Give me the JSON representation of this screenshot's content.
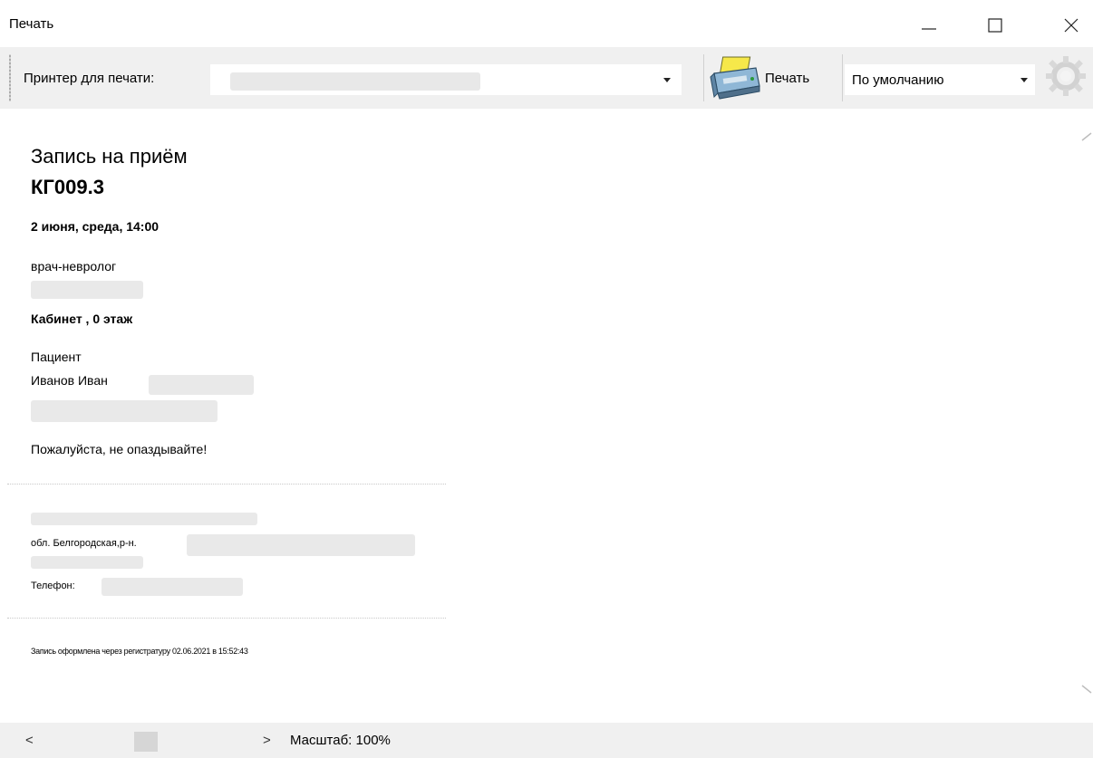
{
  "window": {
    "title": "Печать",
    "controls": {
      "minimize_icon": "minimize-icon",
      "maximize_icon": "maximize-icon",
      "close_icon": "close-icon"
    }
  },
  "toolbar": {
    "printer_label": "Принтер для печати:",
    "printer_value": "",
    "print_button_label": "Печать",
    "print_icon": "printer-icon",
    "mode_value": "По умолчанию",
    "settings_icon": "gear-icon"
  },
  "document": {
    "heading": "Запись на приём",
    "code": "КГ009.3",
    "datetime": "2 июня, среда, 14:00",
    "specialty": "врач-невролог",
    "cabinet": "Кабинет , 0 этаж",
    "patient_label": "Пациент",
    "patient_name": "Иванов Иван",
    "reminder": "Пожалуйста, не опаздывайте!",
    "address": "обл. Белгородская,р-н.",
    "phone_label": "Телефон:",
    "footer_note": "Запись оформлена через регистратуру 02.06.2021 в 15:52:43"
  },
  "statusbar": {
    "scroll_left": "<",
    "scroll_right": ">",
    "zoom": "Масштаб: 100%"
  }
}
